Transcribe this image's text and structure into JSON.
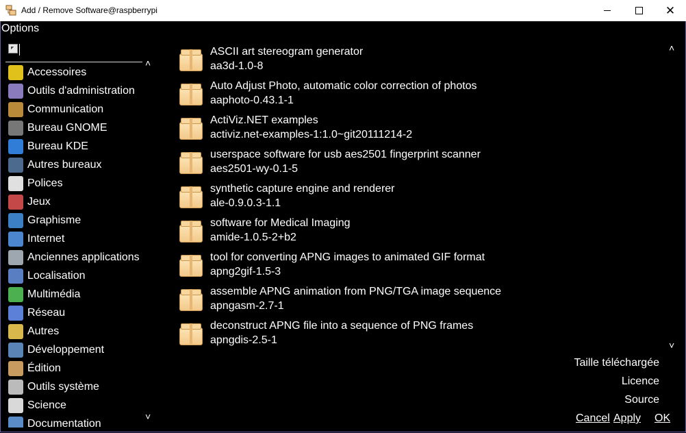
{
  "window": {
    "title": "Add / Remove Software@raspberrypi"
  },
  "menu": {
    "options": "Options"
  },
  "search": {
    "value": "",
    "placeholder": ""
  },
  "categories": [
    {
      "label": "Accessoires",
      "icon": "accessories-icon",
      "color": "#e0c01b"
    },
    {
      "label": "Outils d'administration",
      "icon": "admin-tools-icon",
      "color": "#8a7bbd"
    },
    {
      "label": "Communication",
      "icon": "communication-icon",
      "color": "#b88a3a"
    },
    {
      "label": "Bureau GNOME",
      "icon": "gnome-icon",
      "color": "#777777"
    },
    {
      "label": "Bureau KDE",
      "icon": "kde-icon",
      "color": "#2f7dd6"
    },
    {
      "label": "Autres bureaux",
      "icon": "desktop-icon",
      "color": "#4b6a8e"
    },
    {
      "label": "Polices",
      "icon": "fonts-icon",
      "color": "#e0e0e0"
    },
    {
      "label": "Jeux",
      "icon": "games-icon",
      "color": "#c44848"
    },
    {
      "label": "Graphisme",
      "icon": "graphics-icon",
      "color": "#3c7fc4"
    },
    {
      "label": "Internet",
      "icon": "internet-icon",
      "color": "#4c86cf"
    },
    {
      "label": "Anciennes applications",
      "icon": "legacy-apps-icon",
      "color": "#9ea7b0"
    },
    {
      "label": "Localisation",
      "icon": "localization-icon",
      "color": "#5a7ec2"
    },
    {
      "label": "Multimédia",
      "icon": "multimedia-icon",
      "color": "#4caf50"
    },
    {
      "label": "Réseau",
      "icon": "network-icon",
      "color": "#5c7fd8"
    },
    {
      "label": "Autres",
      "icon": "other-icon",
      "color": "#d8b84c"
    },
    {
      "label": "Développement",
      "icon": "development-icon",
      "color": "#5b84b6"
    },
    {
      "label": "Édition",
      "icon": "office-icon",
      "color": "#c89c60"
    },
    {
      "label": "Outils système",
      "icon": "system-tools-icon",
      "color": "#bbbbbb"
    },
    {
      "label": "Science",
      "icon": "science-icon",
      "color": "#d9d9d9"
    },
    {
      "label": "Documentation",
      "icon": "documentation-icon",
      "color": "#5a8bc6"
    }
  ],
  "packages": [
    {
      "description": "ASCII art stereogram generator",
      "name": "aa3d-1.0-8"
    },
    {
      "description": "Auto Adjust Photo, automatic color correction of photos",
      "name": "aaphoto-0.43.1-1"
    },
    {
      "description": "ActiViz.NET examples",
      "name": "activiz.net-examples-1:1.0~git20111214-2"
    },
    {
      "description": "userspace software for usb aes2501 fingerprint scanner",
      "name": "aes2501-wy-0.1-5"
    },
    {
      "description": "synthetic capture engine and renderer",
      "name": "ale-0.9.0.3-1.1"
    },
    {
      "description": "software for Medical Imaging",
      "name": "amide-1.0.5-2+b2"
    },
    {
      "description": "tool for converting APNG images to animated GIF format",
      "name": "apng2gif-1.5-3"
    },
    {
      "description": "assemble APNG animation from PNG/TGA image sequence",
      "name": "apngasm-2.7-1"
    },
    {
      "description": "deconstruct APNG file into a sequence of PNG frames",
      "name": "apngdis-2.5-1"
    }
  ],
  "details": {
    "download_size_label": "Taille téléchargée",
    "license_label": "Licence",
    "source_label": "Source"
  },
  "buttons": {
    "cancel": "Cancel",
    "apply": "Apply",
    "ok": "OK"
  }
}
